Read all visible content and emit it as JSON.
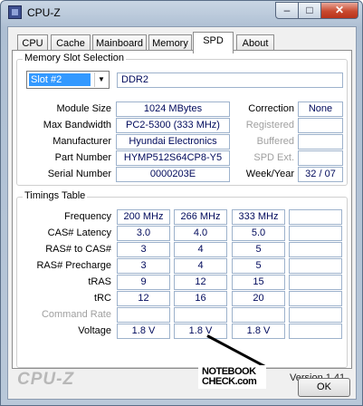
{
  "window": {
    "title": "CPU-Z",
    "minimize": "–",
    "maximize": "□",
    "close": "✕"
  },
  "tabs": [
    {
      "label": "CPU"
    },
    {
      "label": "Cache"
    },
    {
      "label": "Mainboard"
    },
    {
      "label": "Memory"
    },
    {
      "label": "SPD"
    },
    {
      "label": "About"
    }
  ],
  "slot_selection": {
    "title": "Memory Slot Selection",
    "selected": "Slot #2",
    "type": "DDR2"
  },
  "module": {
    "size_label": "Module Size",
    "size": "1024 MBytes",
    "bandwidth_label": "Max Bandwidth",
    "bandwidth": "PC2-5300 (333 MHz)",
    "manufacturer_label": "Manufacturer",
    "manufacturer": "Hyundai Electronics",
    "part_label": "Part Number",
    "part": "HYMP512S64CP8-Y5",
    "serial_label": "Serial Number",
    "serial": "0000203E",
    "correction_label": "Correction",
    "correction": "None",
    "registered_label": "Registered",
    "registered": "",
    "buffered_label": "Buffered",
    "buffered": "",
    "spd_ext_label": "SPD Ext.",
    "spd_ext": "",
    "week_year_label": "Week/Year",
    "week_year": "32 / 07"
  },
  "timings": {
    "title": "Timings Table",
    "rows": [
      {
        "label": "Frequency",
        "values": [
          "200 MHz",
          "266 MHz",
          "333 MHz",
          ""
        ]
      },
      {
        "label": "CAS# Latency",
        "values": [
          "3.0",
          "4.0",
          "5.0",
          ""
        ]
      },
      {
        "label": "RAS# to CAS#",
        "values": [
          "3",
          "4",
          "5",
          ""
        ]
      },
      {
        "label": "RAS# Precharge",
        "values": [
          "3",
          "4",
          "5",
          ""
        ]
      },
      {
        "label": "tRAS",
        "values": [
          "9",
          "12",
          "15",
          ""
        ]
      },
      {
        "label": "tRC",
        "values": [
          "12",
          "16",
          "20",
          ""
        ]
      },
      {
        "label": "Command Rate",
        "values": [
          "",
          "",
          "",
          ""
        ]
      },
      {
        "label": "Voltage",
        "values": [
          "1.8 V",
          "1.8 V",
          "1.8 V",
          ""
        ]
      }
    ]
  },
  "footer": {
    "version": "Version 1.41",
    "brand": "CPU-Z",
    "ok": "OK",
    "watermark_line1": "NOTEBOOK",
    "watermark_line2": "CHECK.com"
  }
}
